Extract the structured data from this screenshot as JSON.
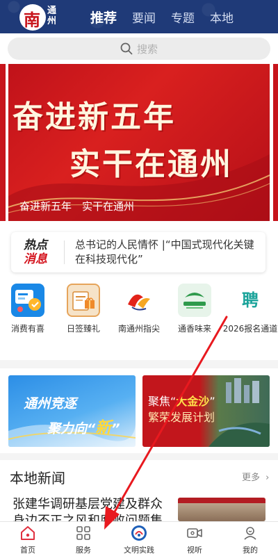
{
  "header": {
    "logo_glyph": "南",
    "logo_text": "通州",
    "tabs": [
      {
        "label": "推荐",
        "active": true
      },
      {
        "label": "要闻",
        "active": false
      },
      {
        "label": "专题",
        "active": false
      },
      {
        "label": "本地",
        "active": false
      }
    ]
  },
  "search": {
    "placeholder": "搜索",
    "icon": "search-icon"
  },
  "banner": {
    "line1": "奋进新五年",
    "line2": "实干在通州",
    "caption": "奋进新五年　实干在通州"
  },
  "hot": {
    "badge_top": "热点",
    "badge_bottom": "消息",
    "text": "总书记的人民情怀 |“中国式现代化关键在科技现代化”"
  },
  "quick_links": [
    {
      "label": "消费有喜",
      "icon": "coupon-icon"
    },
    {
      "label": "日签臻礼",
      "icon": "gift-calendar-icon"
    },
    {
      "label": "南通州指尖",
      "icon": "brand-logo-icon"
    },
    {
      "label": "通香味来",
      "icon": "food-brand-icon"
    },
    {
      "label": "2026报名通道",
      "icon": "recruit-icon",
      "icon_text": "聘"
    }
  ],
  "promo_cards": {
    "left": {
      "line1": "通州竞逐",
      "line2_prefix": "聚力向“",
      "line2_accent": "新",
      "line2_suffix": "”"
    },
    "right": {
      "line1_prefix": "聚焦“",
      "line1_accent": "大金沙",
      "line1_suffix": "”",
      "line2": "繁荣发展计划"
    }
  },
  "local_news": {
    "title": "本地新闻",
    "more": "更多",
    "headline": "张建华调研基层党建及群众身边不正之风和腐败问题集"
  },
  "bottom_nav": [
    {
      "label": "首页",
      "icon": "home-icon",
      "active": true
    },
    {
      "label": "服务",
      "icon": "grid-icon",
      "active": false
    },
    {
      "label": "文明实践",
      "icon": "civilization-icon",
      "active": false
    },
    {
      "label": "视听",
      "icon": "video-icon",
      "active": false
    },
    {
      "label": "我的",
      "icon": "profile-icon",
      "active": false
    }
  ],
  "colors": {
    "header_bg": "#1f3a78",
    "brand_red": "#c8161d",
    "annotation_arrow": "#e8191f"
  }
}
